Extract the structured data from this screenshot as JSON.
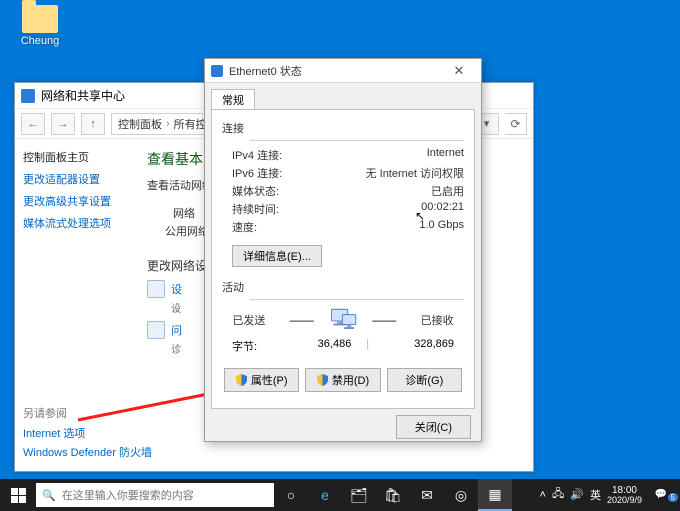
{
  "desktop": {
    "icon_label": "Cheung"
  },
  "control_panel": {
    "title": "网络和共享中心",
    "breadcrumb": [
      "控制面板",
      "所有控制面板项"
    ],
    "side_header": "控制面板主页",
    "side_links": [
      "更改适配器设置",
      "更改高级共享设置",
      "媒体流式处理选项"
    ],
    "main_title": "查看基本网",
    "main_sub": "查看活动网络",
    "net_category_label": "网络",
    "net_type": "公用网络",
    "change_header": "更改网络设置",
    "link1": "设",
    "link1_desc": "设",
    "link2": "问",
    "link2_desc": "诊",
    "see_also_header": "另请参阅",
    "see_also_links": [
      "Internet 选项",
      "Windows Defender 防火墙"
    ]
  },
  "dialog": {
    "title": "Ethernet0 状态",
    "tab": "常规",
    "conn_header": "连接",
    "rows": {
      "ipv4_k": "IPv4 连接:",
      "ipv4_v": "Internet",
      "ipv6_k": "IPv6 连接:",
      "ipv6_v": "无 Internet 访问权限",
      "media_k": "媒体状态:",
      "media_v": "已启用",
      "dur_k": "持续时间:",
      "dur_v": "00:02:21",
      "speed_k": "速度:",
      "speed_v": "1.0 Gbps"
    },
    "detail_btn": "详细信息(E)...",
    "activity_header": "活动",
    "sent_label": "已发送",
    "recv_label": "已接收",
    "bytes_label": "字节:",
    "sent_bytes": "36,486",
    "recv_bytes": "328,869",
    "buttons": {
      "props": "属性(P)",
      "disable": "禁用(D)",
      "diag": "诊断(G)",
      "close": "关闭(C)"
    }
  },
  "taskbar": {
    "search_placeholder": "在这里输入你要搜索的内容",
    "ime": "英",
    "time": "18:00",
    "date": "2020/9/9",
    "notif_count": "5"
  }
}
